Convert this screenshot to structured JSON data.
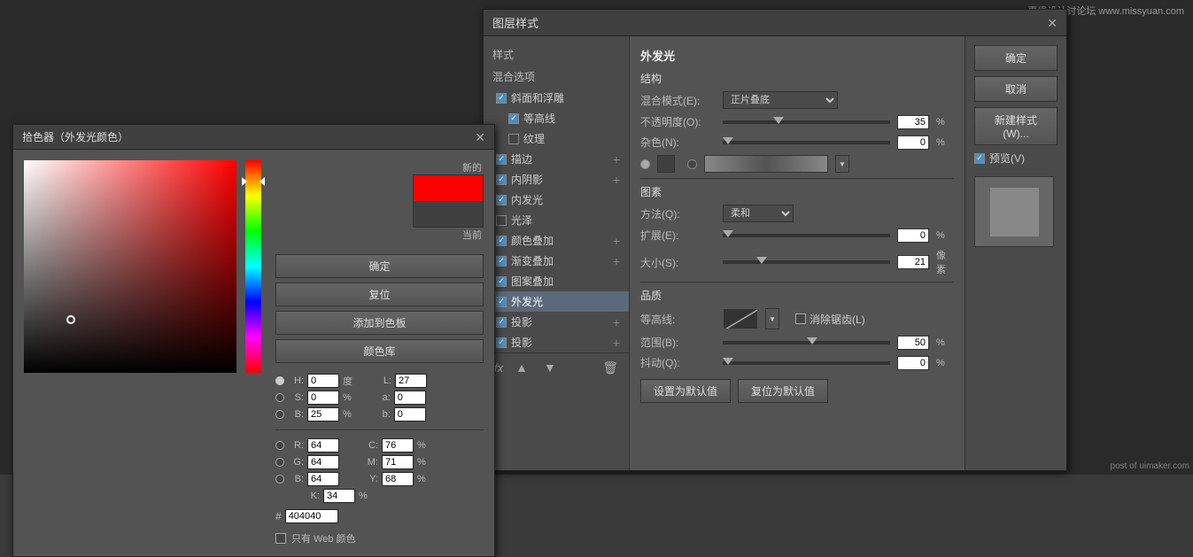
{
  "watermark": {
    "text": "惠缘设计讨论坛 www.missyuan.com"
  },
  "color_picker": {
    "title": "拾色器（外发光颜色）",
    "new_label": "新的",
    "current_label": "当前",
    "buttons": {
      "ok": "确定",
      "reset": "复位",
      "add_to_palette": "添加到色板",
      "color_library": "颜色库"
    },
    "h_label": "H:",
    "h_value": "0",
    "h_unit": "度",
    "s_label": "S:",
    "s_value": "0",
    "s_unit": "%",
    "b_label": "B:",
    "b_value": "25",
    "b_unit": "%",
    "r_label": "R:",
    "r_value": "64",
    "g_label": "G:",
    "g_value": "64",
    "b2_label": "B:",
    "b2_value": "64",
    "l_label": "L:",
    "l_value": "27",
    "a_label": "a:",
    "a_value": "0",
    "b3_label": "b:",
    "b3_value": "0",
    "c_label": "C:",
    "c_value": "76",
    "c_unit": "%",
    "m_label": "M:",
    "m_value": "71",
    "m_unit": "%",
    "y_label": "Y:",
    "y_value": "68",
    "y_unit": "%",
    "k_label": "K:",
    "k_value": "34",
    "k_unit": "%",
    "hex_label": "#",
    "hex_value": "404040",
    "web_color_label": "只有 Web 颜色"
  },
  "layer_style": {
    "title": "图层样式",
    "styles_panel": {
      "style_label": "样式",
      "blend_label": "混合选项",
      "items": [
        {
          "label": "斜面和浮雕",
          "checked": true,
          "has_sub": false
        },
        {
          "label": "等高线",
          "checked": true,
          "has_sub": true,
          "indent": true
        },
        {
          "label": "纹理",
          "checked": false,
          "has_sub": true,
          "indent": true
        },
        {
          "label": "描边",
          "checked": true,
          "has_sub": false
        },
        {
          "label": "内阴影",
          "checked": true,
          "has_sub": false
        },
        {
          "label": "内发光",
          "checked": true,
          "has_sub": false
        },
        {
          "label": "光泽",
          "checked": false,
          "has_sub": false
        },
        {
          "label": "颜色叠加",
          "checked": true,
          "has_sub": false
        },
        {
          "label": "渐变叠加",
          "checked": true,
          "has_sub": false
        },
        {
          "label": "图案叠加",
          "checked": true,
          "has_sub": false
        },
        {
          "label": "外发光",
          "checked": true,
          "active": true,
          "has_sub": false
        },
        {
          "label": "投影",
          "checked": true,
          "has_sub": false
        },
        {
          "label": "投影",
          "checked": true,
          "has_sub": false
        }
      ]
    },
    "outer_glow": {
      "section_title": "外发光",
      "sub_title_structure": "结构",
      "blend_mode_label": "混合模式(E):",
      "blend_mode_value": "正片叠底",
      "opacity_label": "不透明度(O):",
      "opacity_value": "35",
      "opacity_unit": "%",
      "noise_label": "杂色(N):",
      "noise_value": "0",
      "noise_unit": "%",
      "sub_title_elements": "图素",
      "method_label": "方法(Q):",
      "method_value": "柔和",
      "spread_label": "扩展(E):",
      "spread_value": "0",
      "spread_unit": "%",
      "size_label": "大小(S):",
      "size_value": "21",
      "size_unit": "像素",
      "sub_title_quality": "品质",
      "contour_label": "等高线:",
      "anti_alias_label": "消除锯齿(L)",
      "range_label": "范围(B):",
      "range_value": "50",
      "range_unit": "%",
      "jitter_label": "抖动(Q):",
      "jitter_value": "0",
      "jitter_unit": "%",
      "btn_set_default": "设置为默认值",
      "btn_reset_default": "复位为默认值"
    },
    "right_panel": {
      "ok": "确定",
      "cancel": "取消",
      "new_style": "新建样式(W)...",
      "preview_label": "预览(V)"
    }
  },
  "post_text": "post of uimaker.com"
}
